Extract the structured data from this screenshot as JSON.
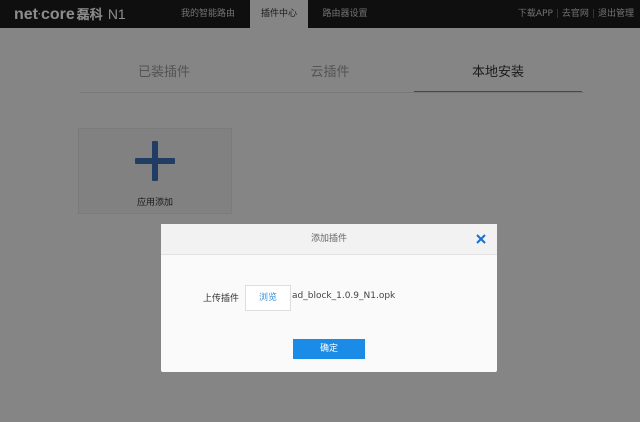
{
  "header": {
    "logo_text": "net",
    "logo_dot": "·",
    "logo_text2": "core",
    "logo_cn": "磊科",
    "logo_model": "N1",
    "nav": [
      {
        "label": "我的智能路由"
      },
      {
        "label": "插件中心"
      },
      {
        "label": "路由器设置"
      }
    ],
    "links": [
      {
        "label": "下载APP"
      },
      {
        "label": "去官网"
      },
      {
        "label": "退出管理"
      }
    ]
  },
  "plugin_tabs": [
    {
      "label": "已装插件"
    },
    {
      "label": "云插件"
    },
    {
      "label": "本地安装"
    }
  ],
  "add_card": {
    "label": "应用添加"
  },
  "dialog": {
    "title": "添加插件",
    "upload_label": "上传插件",
    "browse_label": "浏览",
    "file_name": "ad_block_1.0.9_N1.opk",
    "confirm_label": "确定"
  },
  "colors": {
    "accent": "#1a8ce8",
    "plus": "#3d6fb5",
    "topbar": "#1c1c1c"
  }
}
